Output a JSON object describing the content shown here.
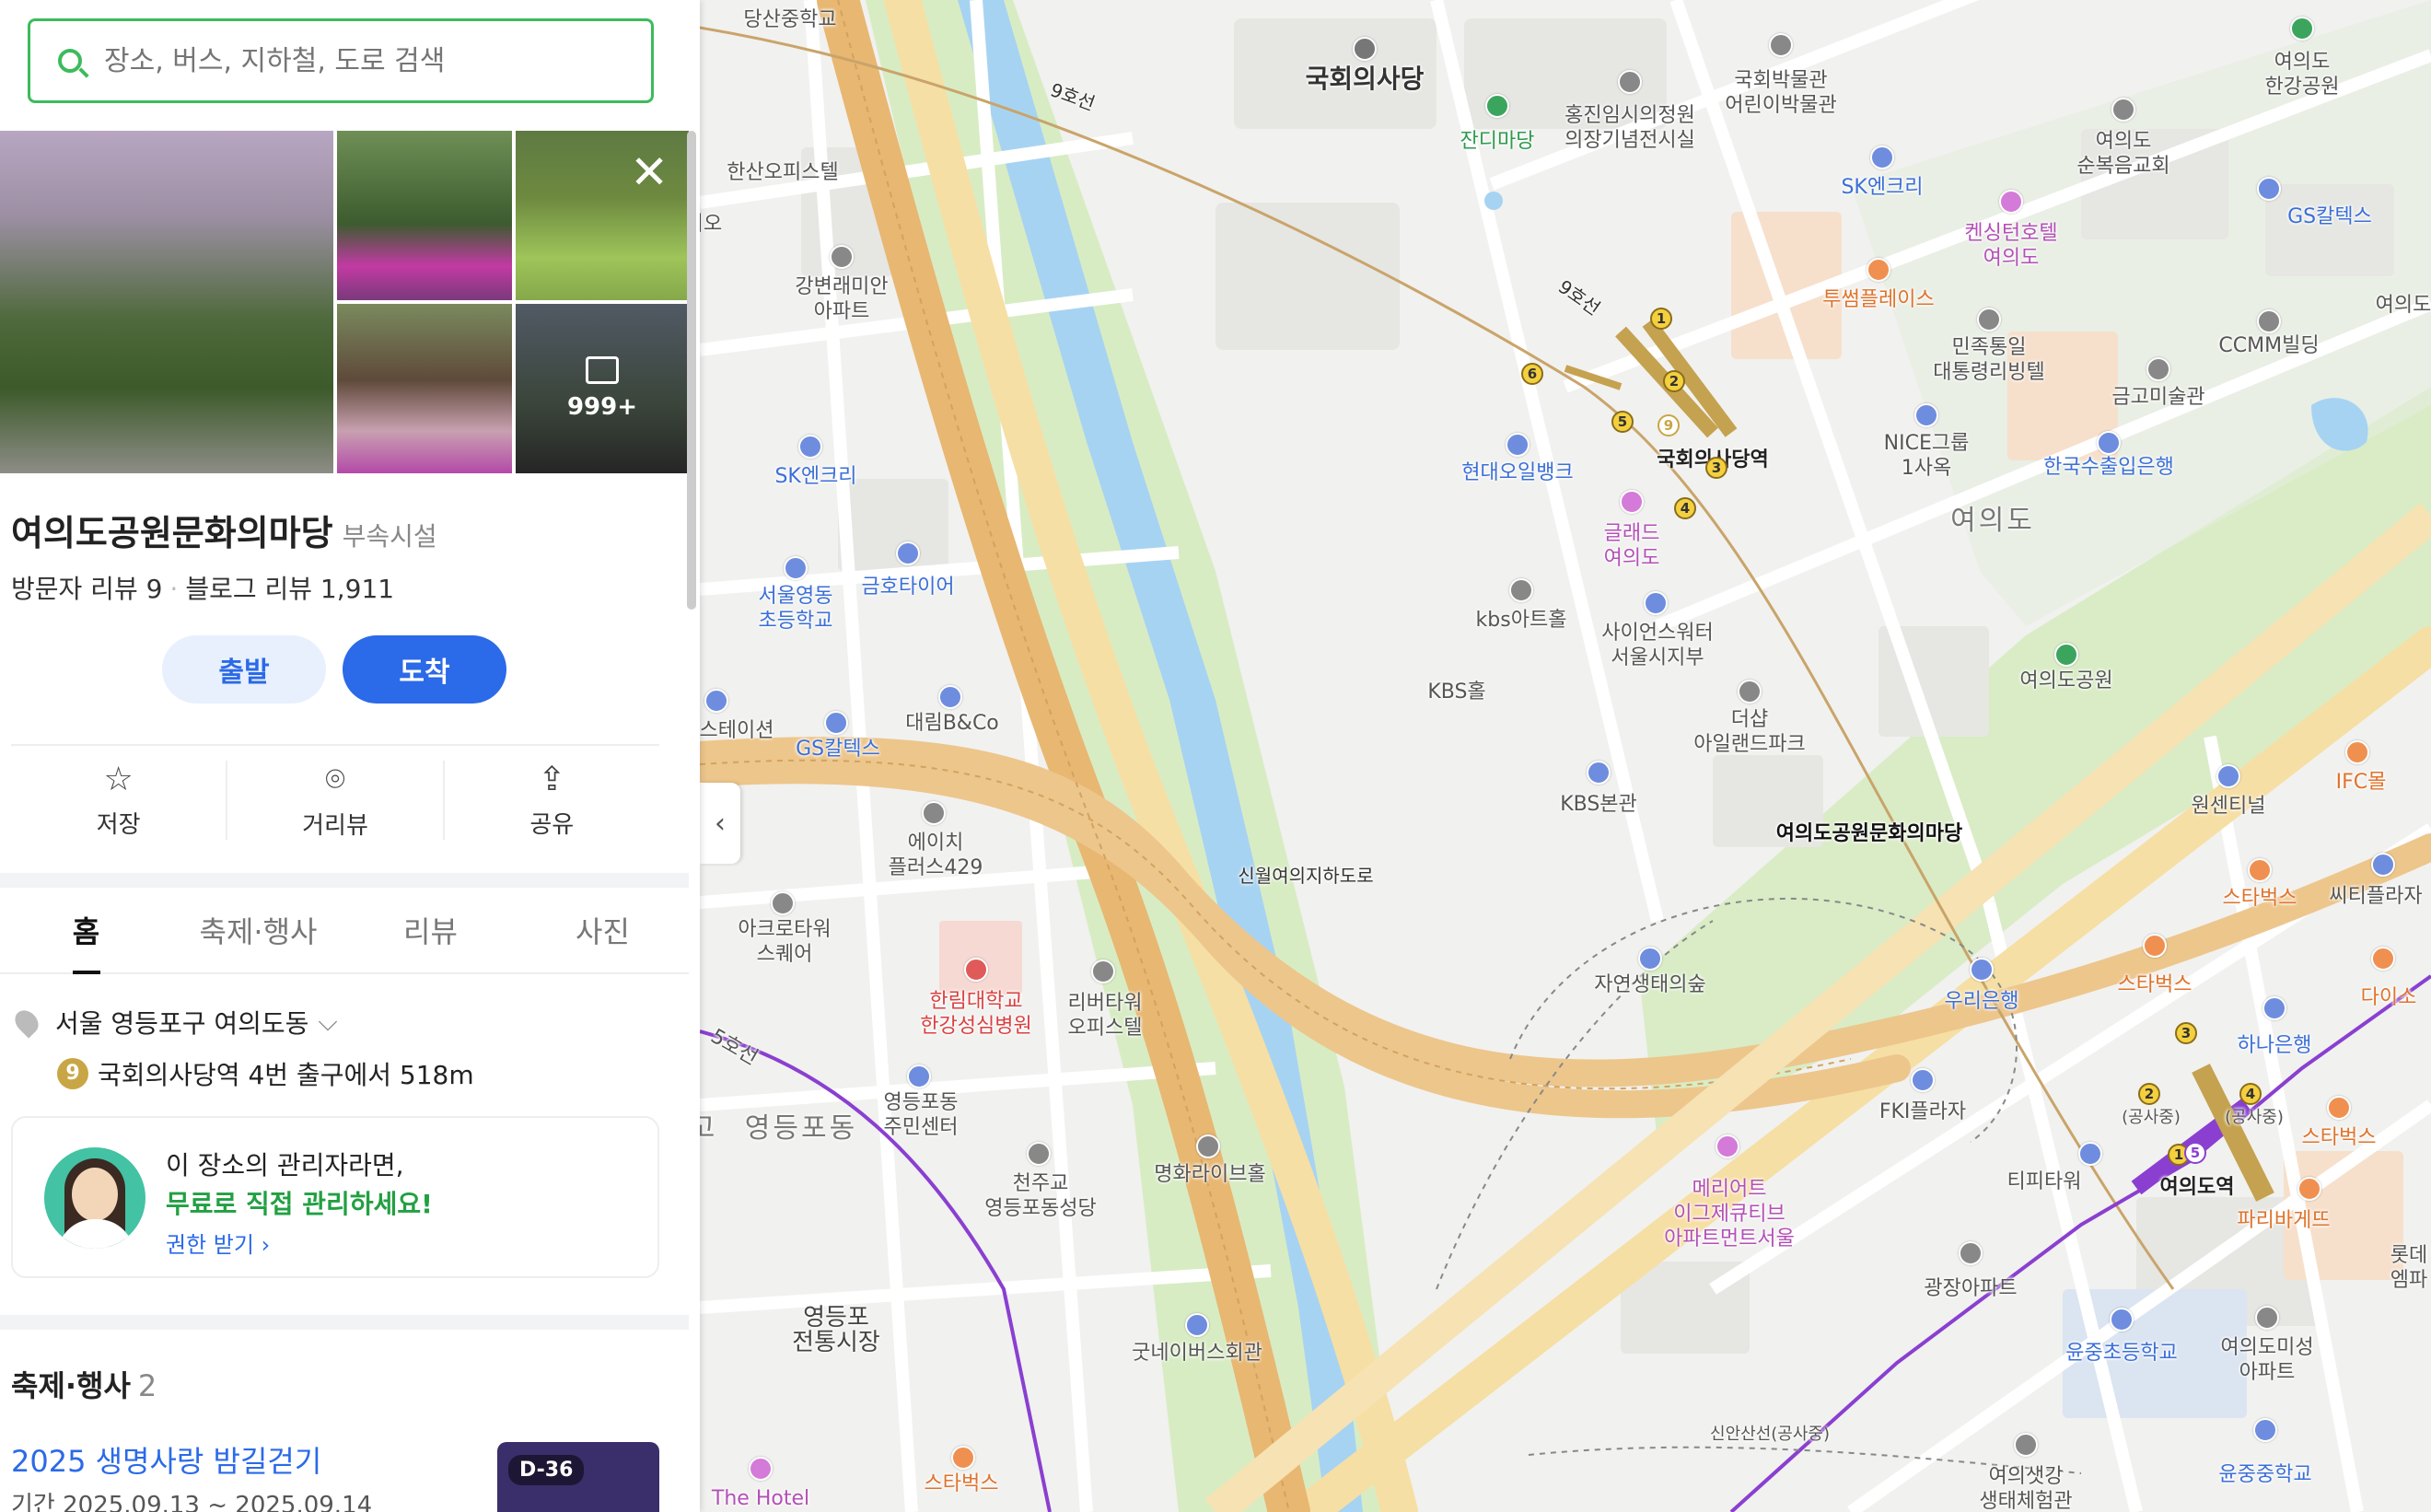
{
  "search": {
    "placeholder": "장소, 버스, 지하철, 도로 검색"
  },
  "photos": {
    "more_count": "999+"
  },
  "place": {
    "name": "여의도공원문화의마당",
    "category": "부속시설",
    "visitor_reviews": "방문자 리뷰 9",
    "blog_reviews": "블로그 리뷰 1,911"
  },
  "buttons": {
    "depart": "출발",
    "arrive": "도착"
  },
  "actions": [
    {
      "label": "저장",
      "icon": "star-icon"
    },
    {
      "label": "거리뷰",
      "icon": "pin-icon"
    },
    {
      "label": "공유",
      "icon": "share-icon"
    }
  ],
  "tabs": [
    "홈",
    "축제·행사",
    "리뷰",
    "사진"
  ],
  "info": {
    "address": "서울 영등포구 여의도동",
    "subway_line": "9",
    "subway_text": "국회의사당역 4번 출구에서 518m"
  },
  "promo": {
    "line1": "이 장소의 관리자라면,",
    "line2": "무료로 직접 관리하세요!",
    "link": "권한 받기"
  },
  "festivals": {
    "header": "축제·행사",
    "count": "2",
    "event_title": "2025 생명사랑 밤길걷기",
    "event_date": "기간 2025.09.13 ~ 2025.09.14",
    "dday": "D-36"
  },
  "map": {
    "destination": "여의도공원문화의마당",
    "labels": {
      "dangsan_school": "당산중학교",
      "national_assembly": "국회의사당",
      "jandi": "잔디마당",
      "hongjin": "홍진임시의정원\n의장기념전시실",
      "museum": "국회박물관\n어린이박물관",
      "yeouido_park_n": "여의도\n한강공원",
      "hansan": "한산오피스텔",
      "line9a": "9호선",
      "line9b": "9호선",
      "gangbyeon": "강변래미안\n아파트",
      "church": "여의도\n순복음교회",
      "sk1": "SK엔크리",
      "kensington": "켄싱턴호텔\n여의도",
      "gs1": "GS칼텍스",
      "twosome": "투썸플레이스",
      "minjok": "민족통일\n대통령리빙텔",
      "ccmm": "CCMM빌딩",
      "sk2": "SK엔크리",
      "assembly_stn": "국회의사당역",
      "hyundai": "현대오일뱅크",
      "nice": "NICE그룹\n1사옥",
      "geumgo": "금고미술관",
      "export_bank": "한국수출입은행",
      "glad": "글래드\n여의도",
      "yeouido_area": "여의도",
      "kbs_art": "kbs아트홀",
      "science": "사이언스워터\n서울시지부",
      "seoul_school": "서울영동\n초등학교",
      "kumho": "금호타이어",
      "kbs_hall": "KBS홀",
      "yeouido_park": "여의도공원",
      "daerim": "대림B&Co",
      "station_cut": "스테이션",
      "gs2": "GS칼텍스",
      "theshop": "더샵\n아일랜드파크",
      "kbs_main": "KBS본관",
      "ifc": "IFC몰",
      "one_center": "원센티널",
      "eh": "에이치\n플러스429",
      "tunnel": "신월여의지하도로",
      "starbucks1": "스타벅스",
      "city_plaza": "씨티플라자",
      "acro": "아크로타워\n스퀘어",
      "nature": "자연생태의숲",
      "starbucks2": "스타벅스",
      "daiso": "다이소",
      "woori": "우리은행",
      "hana": "하나은행",
      "hallym": "한림대학교\n한강성심병원",
      "river_tower": "리버타워\n오피스텔",
      "fki": "FKI플라자",
      "gongsa1": "(공사중)",
      "gongsa2": "(공사중)",
      "starbucks3": "스타벅스",
      "yeongdeungpo_dong": "영등포동",
      "community": "영등포동\n주민센터",
      "tippy": "티피타워",
      "yeouido_stn": "여의도역",
      "paris": "파리바게뜨",
      "meriot": "메리어트\n이그제큐티브\n아파트먼트서울",
      "cheonju": "천주교\n영등포동성당",
      "myunghwa": "명화라이브홀",
      "gwangjang": "광장아파트",
      "lotte": "롯데\n엠파",
      "market": "영등포\n전통시장",
      "goodney": "굿네이버스회관",
      "yunjung": "윤중초등학교",
      "misung": "여의도미성\n아파트",
      "sinan": "신안산선(공사중)",
      "eco": "여의샛강\n생태체험관",
      "yunjung_mid": "윤중중학교",
      "starbucks4": "스타벅스",
      "thehotel": "The Hotel",
      "line5": "5호선",
      "io": "의오",
      "go": "고",
      "yeouido_cut": "여의도"
    }
  }
}
